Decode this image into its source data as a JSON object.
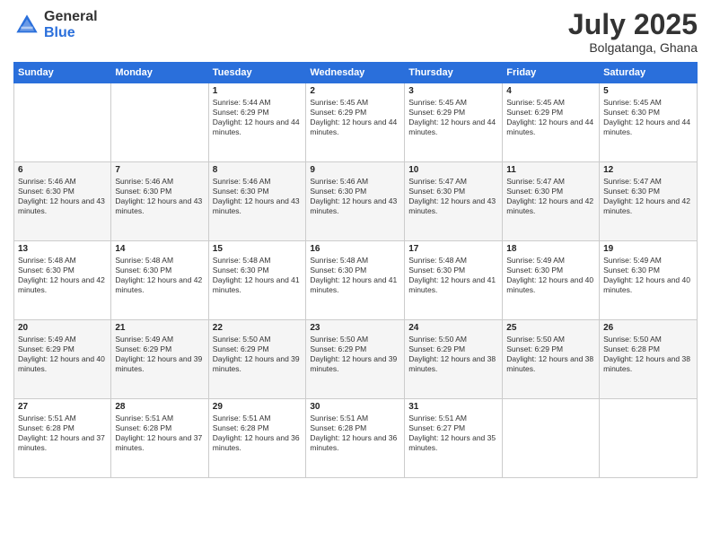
{
  "header": {
    "logo_general": "General",
    "logo_blue": "Blue",
    "month": "July 2025",
    "location": "Bolgatanga, Ghana"
  },
  "weekdays": [
    "Sunday",
    "Monday",
    "Tuesday",
    "Wednesday",
    "Thursday",
    "Friday",
    "Saturday"
  ],
  "weeks": [
    [
      {
        "day": "",
        "sunrise": "",
        "sunset": "",
        "daylight": ""
      },
      {
        "day": "",
        "sunrise": "",
        "sunset": "",
        "daylight": ""
      },
      {
        "day": "1",
        "sunrise": "Sunrise: 5:44 AM",
        "sunset": "Sunset: 6:29 PM",
        "daylight": "Daylight: 12 hours and 44 minutes."
      },
      {
        "day": "2",
        "sunrise": "Sunrise: 5:45 AM",
        "sunset": "Sunset: 6:29 PM",
        "daylight": "Daylight: 12 hours and 44 minutes."
      },
      {
        "day": "3",
        "sunrise": "Sunrise: 5:45 AM",
        "sunset": "Sunset: 6:29 PM",
        "daylight": "Daylight: 12 hours and 44 minutes."
      },
      {
        "day": "4",
        "sunrise": "Sunrise: 5:45 AM",
        "sunset": "Sunset: 6:29 PM",
        "daylight": "Daylight: 12 hours and 44 minutes."
      },
      {
        "day": "5",
        "sunrise": "Sunrise: 5:45 AM",
        "sunset": "Sunset: 6:30 PM",
        "daylight": "Daylight: 12 hours and 44 minutes."
      }
    ],
    [
      {
        "day": "6",
        "sunrise": "Sunrise: 5:46 AM",
        "sunset": "Sunset: 6:30 PM",
        "daylight": "Daylight: 12 hours and 43 minutes."
      },
      {
        "day": "7",
        "sunrise": "Sunrise: 5:46 AM",
        "sunset": "Sunset: 6:30 PM",
        "daylight": "Daylight: 12 hours and 43 minutes."
      },
      {
        "day": "8",
        "sunrise": "Sunrise: 5:46 AM",
        "sunset": "Sunset: 6:30 PM",
        "daylight": "Daylight: 12 hours and 43 minutes."
      },
      {
        "day": "9",
        "sunrise": "Sunrise: 5:46 AM",
        "sunset": "Sunset: 6:30 PM",
        "daylight": "Daylight: 12 hours and 43 minutes."
      },
      {
        "day": "10",
        "sunrise": "Sunrise: 5:47 AM",
        "sunset": "Sunset: 6:30 PM",
        "daylight": "Daylight: 12 hours and 43 minutes."
      },
      {
        "day": "11",
        "sunrise": "Sunrise: 5:47 AM",
        "sunset": "Sunset: 6:30 PM",
        "daylight": "Daylight: 12 hours and 42 minutes."
      },
      {
        "day": "12",
        "sunrise": "Sunrise: 5:47 AM",
        "sunset": "Sunset: 6:30 PM",
        "daylight": "Daylight: 12 hours and 42 minutes."
      }
    ],
    [
      {
        "day": "13",
        "sunrise": "Sunrise: 5:48 AM",
        "sunset": "Sunset: 6:30 PM",
        "daylight": "Daylight: 12 hours and 42 minutes."
      },
      {
        "day": "14",
        "sunrise": "Sunrise: 5:48 AM",
        "sunset": "Sunset: 6:30 PM",
        "daylight": "Daylight: 12 hours and 42 minutes."
      },
      {
        "day": "15",
        "sunrise": "Sunrise: 5:48 AM",
        "sunset": "Sunset: 6:30 PM",
        "daylight": "Daylight: 12 hours and 41 minutes."
      },
      {
        "day": "16",
        "sunrise": "Sunrise: 5:48 AM",
        "sunset": "Sunset: 6:30 PM",
        "daylight": "Daylight: 12 hours and 41 minutes."
      },
      {
        "day": "17",
        "sunrise": "Sunrise: 5:48 AM",
        "sunset": "Sunset: 6:30 PM",
        "daylight": "Daylight: 12 hours and 41 minutes."
      },
      {
        "day": "18",
        "sunrise": "Sunrise: 5:49 AM",
        "sunset": "Sunset: 6:30 PM",
        "daylight": "Daylight: 12 hours and 40 minutes."
      },
      {
        "day": "19",
        "sunrise": "Sunrise: 5:49 AM",
        "sunset": "Sunset: 6:30 PM",
        "daylight": "Daylight: 12 hours and 40 minutes."
      }
    ],
    [
      {
        "day": "20",
        "sunrise": "Sunrise: 5:49 AM",
        "sunset": "Sunset: 6:29 PM",
        "daylight": "Daylight: 12 hours and 40 minutes."
      },
      {
        "day": "21",
        "sunrise": "Sunrise: 5:49 AM",
        "sunset": "Sunset: 6:29 PM",
        "daylight": "Daylight: 12 hours and 39 minutes."
      },
      {
        "day": "22",
        "sunrise": "Sunrise: 5:50 AM",
        "sunset": "Sunset: 6:29 PM",
        "daylight": "Daylight: 12 hours and 39 minutes."
      },
      {
        "day": "23",
        "sunrise": "Sunrise: 5:50 AM",
        "sunset": "Sunset: 6:29 PM",
        "daylight": "Daylight: 12 hours and 39 minutes."
      },
      {
        "day": "24",
        "sunrise": "Sunrise: 5:50 AM",
        "sunset": "Sunset: 6:29 PM",
        "daylight": "Daylight: 12 hours and 38 minutes."
      },
      {
        "day": "25",
        "sunrise": "Sunrise: 5:50 AM",
        "sunset": "Sunset: 6:29 PM",
        "daylight": "Daylight: 12 hours and 38 minutes."
      },
      {
        "day": "26",
        "sunrise": "Sunrise: 5:50 AM",
        "sunset": "Sunset: 6:28 PM",
        "daylight": "Daylight: 12 hours and 38 minutes."
      }
    ],
    [
      {
        "day": "27",
        "sunrise": "Sunrise: 5:51 AM",
        "sunset": "Sunset: 6:28 PM",
        "daylight": "Daylight: 12 hours and 37 minutes."
      },
      {
        "day": "28",
        "sunrise": "Sunrise: 5:51 AM",
        "sunset": "Sunset: 6:28 PM",
        "daylight": "Daylight: 12 hours and 37 minutes."
      },
      {
        "day": "29",
        "sunrise": "Sunrise: 5:51 AM",
        "sunset": "Sunset: 6:28 PM",
        "daylight": "Daylight: 12 hours and 36 minutes."
      },
      {
        "day": "30",
        "sunrise": "Sunrise: 5:51 AM",
        "sunset": "Sunset: 6:28 PM",
        "daylight": "Daylight: 12 hours and 36 minutes."
      },
      {
        "day": "31",
        "sunrise": "Sunrise: 5:51 AM",
        "sunset": "Sunset: 6:27 PM",
        "daylight": "Daylight: 12 hours and 35 minutes."
      },
      {
        "day": "",
        "sunrise": "",
        "sunset": "",
        "daylight": ""
      },
      {
        "day": "",
        "sunrise": "",
        "sunset": "",
        "daylight": ""
      }
    ]
  ]
}
